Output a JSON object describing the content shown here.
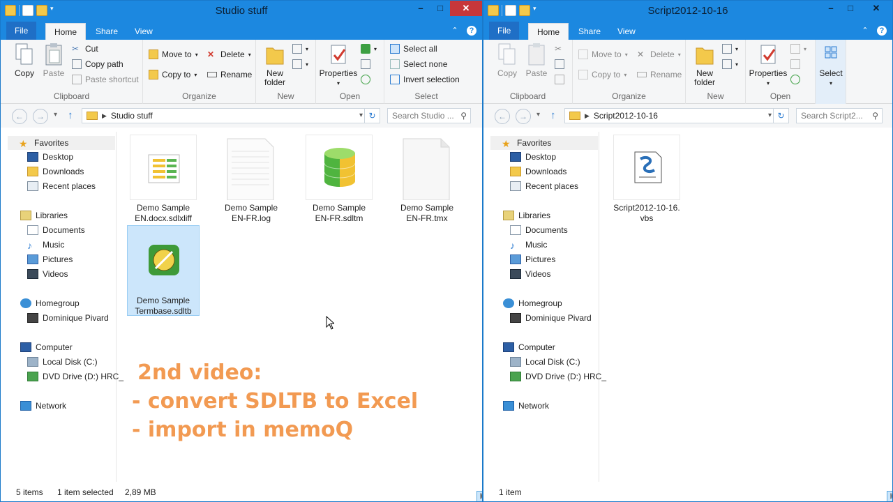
{
  "left_window": {
    "title": "Studio stuff",
    "tabs": {
      "file": "File",
      "home": "Home",
      "share": "Share",
      "view": "View"
    },
    "ribbon": {
      "copy": "Copy",
      "paste": "Paste",
      "cut": "Cut",
      "copy_path": "Copy path",
      "paste_shortcut": "Paste shortcut",
      "clipboard_group": "Clipboard",
      "move_to": "Move to",
      "copy_to": "Copy to",
      "delete": "Delete",
      "rename": "Rename",
      "organize_group": "Organize",
      "new_folder_1": "New",
      "new_folder_2": "folder",
      "new_group": "New",
      "properties": "Properties",
      "open_group": "Open",
      "select_all": "Select all",
      "select_none": "Select none",
      "invert_selection": "Invert selection",
      "select_group": "Select"
    },
    "address": {
      "path": "Studio stuff",
      "search_placeholder": "Search Studio ..."
    },
    "nav": {
      "favorites": "Favorites",
      "desktop": "Desktop",
      "downloads": "Downloads",
      "recent": "Recent places",
      "libraries": "Libraries",
      "documents": "Documents",
      "music": "Music",
      "pictures": "Pictures",
      "videos": "Videos",
      "homegroup": "Homegroup",
      "user": "Dominique Pivard",
      "computer": "Computer",
      "local_disk": "Local Disk (C:)",
      "dvd": "DVD Drive (D:) HRC_",
      "network": "Network"
    },
    "files": [
      {
        "line1": "Demo Sample",
        "line2": "EN.docx.sdlxliff"
      },
      {
        "line1": "Demo Sample",
        "line2": "EN-FR.log"
      },
      {
        "line1": "Demo Sample",
        "line2": "EN-FR.sdltm"
      },
      {
        "line1": "Demo Sample",
        "line2": "EN-FR.tmx"
      },
      {
        "line1": "Demo Sample",
        "line2": "Termbase.sdltb"
      }
    ],
    "overlay": {
      "line1": "2nd video:",
      "line2": "- convert SDLTB to Excel",
      "line3": "- import in memoQ"
    },
    "status": {
      "items": "5 items",
      "selected": "1 item selected",
      "size": "2,89 MB"
    }
  },
  "right_window": {
    "title": "Script2012-10-16",
    "tabs": {
      "file": "File",
      "home": "Home",
      "share": "Share",
      "view": "View"
    },
    "ribbon": {
      "copy": "Copy",
      "paste": "Paste",
      "clipboard_group": "Clipboard",
      "move_to": "Move to",
      "copy_to": "Copy to",
      "delete": "Delete",
      "rename": "Rename",
      "organize_group": "Organize",
      "new_folder_1": "New",
      "new_folder_2": "folder",
      "new_group": "New",
      "properties": "Properties",
      "open_group": "Open",
      "select": "Select"
    },
    "address": {
      "path": "Script2012-10-16",
      "search_placeholder": "Search Script2..."
    },
    "nav": {
      "favorites": "Favorites",
      "desktop": "Desktop",
      "downloads": "Downloads",
      "recent": "Recent places",
      "libraries": "Libraries",
      "documents": "Documents",
      "music": "Music",
      "pictures": "Pictures",
      "videos": "Videos",
      "homegroup": "Homegroup",
      "user": "Dominique Pivard",
      "computer": "Computer",
      "local_disk": "Local Disk (C:)",
      "dvd": "DVD Drive (D:) HRC_",
      "network": "Network"
    },
    "files": [
      {
        "line1": "Script2012-10-16.",
        "line2": "vbs"
      }
    ],
    "status": {
      "items": "1 item"
    }
  },
  "colors": {
    "titlebar": "#1c88e0",
    "close": "#c7373a",
    "overlay_text": "#f29a52",
    "selection": "#cce6fb"
  }
}
